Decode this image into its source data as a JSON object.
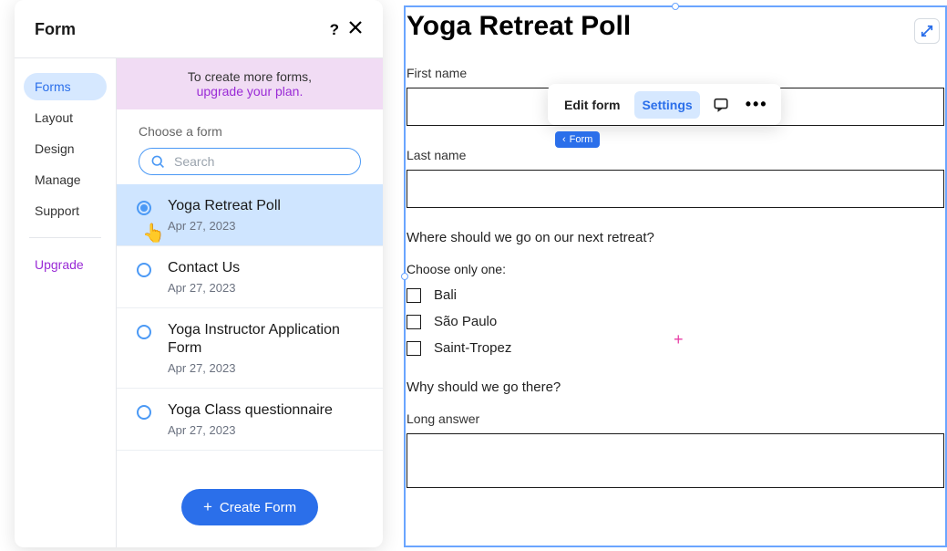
{
  "panel": {
    "title": "Form"
  },
  "tabs": {
    "forms": "Forms",
    "layout": "Layout",
    "design": "Design",
    "manage": "Manage",
    "support": "Support",
    "upgrade": "Upgrade"
  },
  "banner": {
    "line1": "To create more forms,",
    "line2": "upgrade your plan."
  },
  "chooseLabel": "Choose a form",
  "searchPlaceholder": "Search",
  "forms": [
    {
      "title": "Yoga Retreat Poll",
      "date": "Apr 27, 2023"
    },
    {
      "title": "Contact Us",
      "date": "Apr 27, 2023"
    },
    {
      "title": "Yoga Instructor Application Form",
      "date": "Apr 27, 2023"
    },
    {
      "title": "Yoga Class questionnaire",
      "date": "Apr 27, 2023"
    }
  ],
  "createFormLabel": "Create Form",
  "canvas": {
    "formTitle": "Yoga Retreat Poll",
    "firstNameLabel": "First name",
    "lastNameLabel": "Last name",
    "questionLabel": "Where should we go on our next retreat?",
    "chooseOne": "Choose only one:",
    "options": [
      "Bali",
      "São Paulo",
      "Saint-Tropez"
    ],
    "whyLabel": "Why should we go there?",
    "longAnswerLabel": "Long answer"
  },
  "toolbar": {
    "editForm": "Edit form",
    "settings": "Settings",
    "tag": "Form"
  }
}
